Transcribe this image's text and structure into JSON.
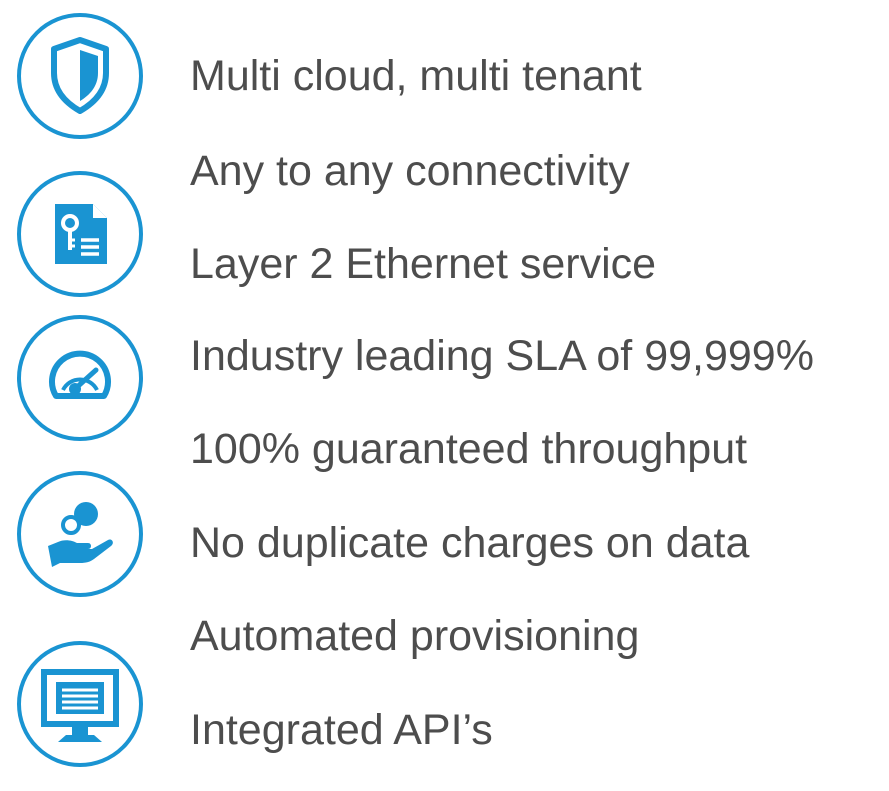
{
  "colors": {
    "accent": "#1a94d2",
    "text": "#4d4d4d",
    "background": "#ffffff"
  },
  "icons": [
    "shield-icon",
    "document-key-icon",
    "speedometer-icon",
    "hand-coins-icon",
    "monitor-icon"
  ],
  "features": [
    "Multi cloud, multi tenant",
    "Any to any connectivity",
    "Layer 2 Ethernet service",
    "Industry leading SLA of 99,999%",
    "100% guaranteed throughput",
    "No duplicate charges on data",
    "Automated provisioning",
    "Integrated API’s"
  ]
}
